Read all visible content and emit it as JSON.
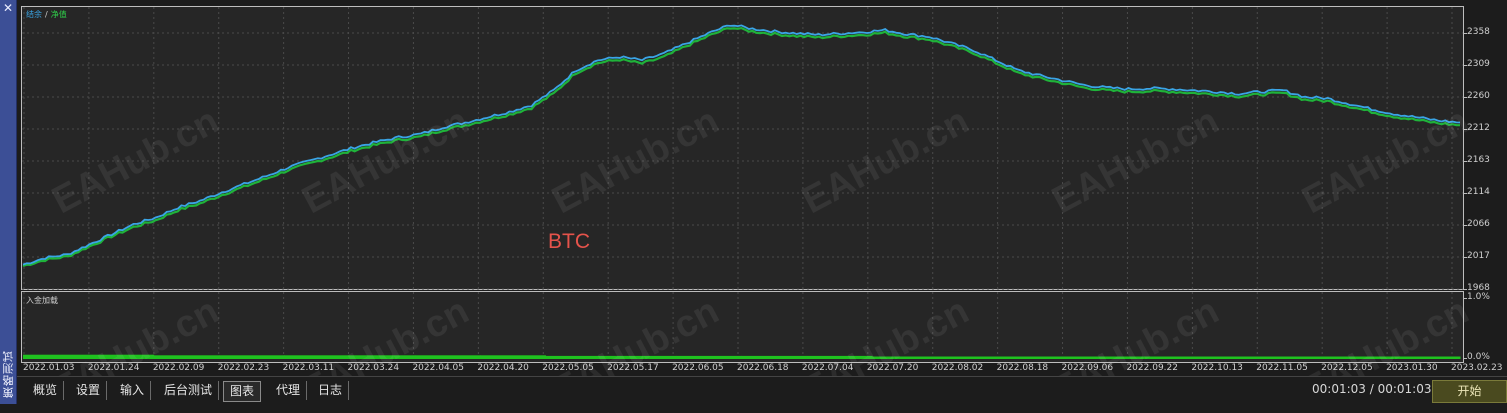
{
  "side_panel": {
    "close_glyph": "✕",
    "title": "策略测试"
  },
  "legend": {
    "balance": "结余",
    "separator": "/",
    "equity": "净值"
  },
  "sub_chart": {
    "label": "入金加载"
  },
  "annotation": "BTC",
  "watermark": "EAHub.cn",
  "colors": {
    "balance": "#3aa5e6",
    "equity": "#1fb33a",
    "deposit": "#1fc21f",
    "annotation": "#e5534b"
  },
  "chart_data": {
    "type": "line",
    "title": "",
    "x_ticks": [
      "2022.01.03",
      "2022.01.24",
      "2022.02.09",
      "2022.02.23",
      "2022.03.11",
      "2022.03.24",
      "2022.04.05",
      "2022.04.20",
      "2022.05.05",
      "2022.05.17",
      "2022.06.05",
      "2022.06.18",
      "2022.07.04",
      "2022.07.20",
      "2022.08.02",
      "2022.08.18",
      "2022.09.06",
      "2022.09.22",
      "2022.10.13",
      "2022.11.05",
      "2022.12.05",
      "2023.01.30",
      "2023.02.23"
    ],
    "y_ticks": [
      "2358",
      "2309",
      "2260",
      "2212",
      "2163",
      "2114",
      "2066",
      "2017",
      "1968"
    ],
    "ylim": [
      1968,
      2374
    ],
    "series": [
      {
        "name": "结余",
        "color": "#3aa5e6",
        "values": [
          2000,
          2010,
          2015,
          2030,
          2045,
          2060,
          2070,
          2085,
          2095,
          2108,
          2120,
          2132,
          2145,
          2155,
          2165,
          2175,
          2183,
          2190,
          2195,
          2205,
          2212,
          2220,
          2228,
          2238,
          2260,
          2290,
          2305,
          2310,
          2305,
          2315,
          2330,
          2345,
          2358,
          2352,
          2348,
          2345,
          2343,
          2345,
          2347,
          2350,
          2344,
          2340,
          2330,
          2320,
          2305,
          2290,
          2282,
          2275,
          2268,
          2264,
          2262,
          2263,
          2262,
          2260,
          2258,
          2255,
          2258,
          2260,
          2250,
          2248,
          2240,
          2232,
          2225,
          2220,
          2215,
          2212
        ]
      },
      {
        "name": "净值",
        "color": "#1fb33a",
        "values": [
          1998,
          2007,
          2012,
          2027,
          2042,
          2056,
          2066,
          2081,
          2091,
          2104,
          2116,
          2128,
          2141,
          2151,
          2161,
          2171,
          2179,
          2186,
          2191,
          2201,
          2208,
          2216,
          2224,
          2234,
          2255,
          2286,
          2301,
          2306,
          2300,
          2310,
          2326,
          2341,
          2354,
          2348,
          2344,
          2341,
          2339,
          2341,
          2343,
          2346,
          2340,
          2336,
          2326,
          2316,
          2301,
          2286,
          2278,
          2271,
          2264,
          2260,
          2258,
          2259,
          2258,
          2256,
          2254,
          2251,
          2254,
          2256,
          2246,
          2244,
          2236,
          2228,
          2221,
          2216,
          2211,
          2208
        ]
      }
    ],
    "deposit_load": {
      "y_ticks": [
        "1.0%",
        "0.0%"
      ],
      "ylim": [
        0,
        1.0
      ],
      "values": [
        0.07,
        0.07,
        0.06,
        0.06,
        0.06,
        0.06,
        0.06,
        0.06,
        0.05,
        0.05,
        0.05,
        0.05,
        0.05,
        0.04,
        0.04,
        0.04,
        0.04,
        0.04,
        0.04,
        0.04,
        0.04,
        0.04,
        0.04
      ]
    }
  },
  "tabs": [
    {
      "label": "概览"
    },
    {
      "label": "设置"
    },
    {
      "label": "输入"
    },
    {
      "label": "后台测试"
    },
    {
      "label": "图表",
      "active": true
    },
    {
      "label": "代理"
    },
    {
      "label": "日志"
    }
  ],
  "timer": "00:01:03 / 00:01:03",
  "start_button": "开始"
}
